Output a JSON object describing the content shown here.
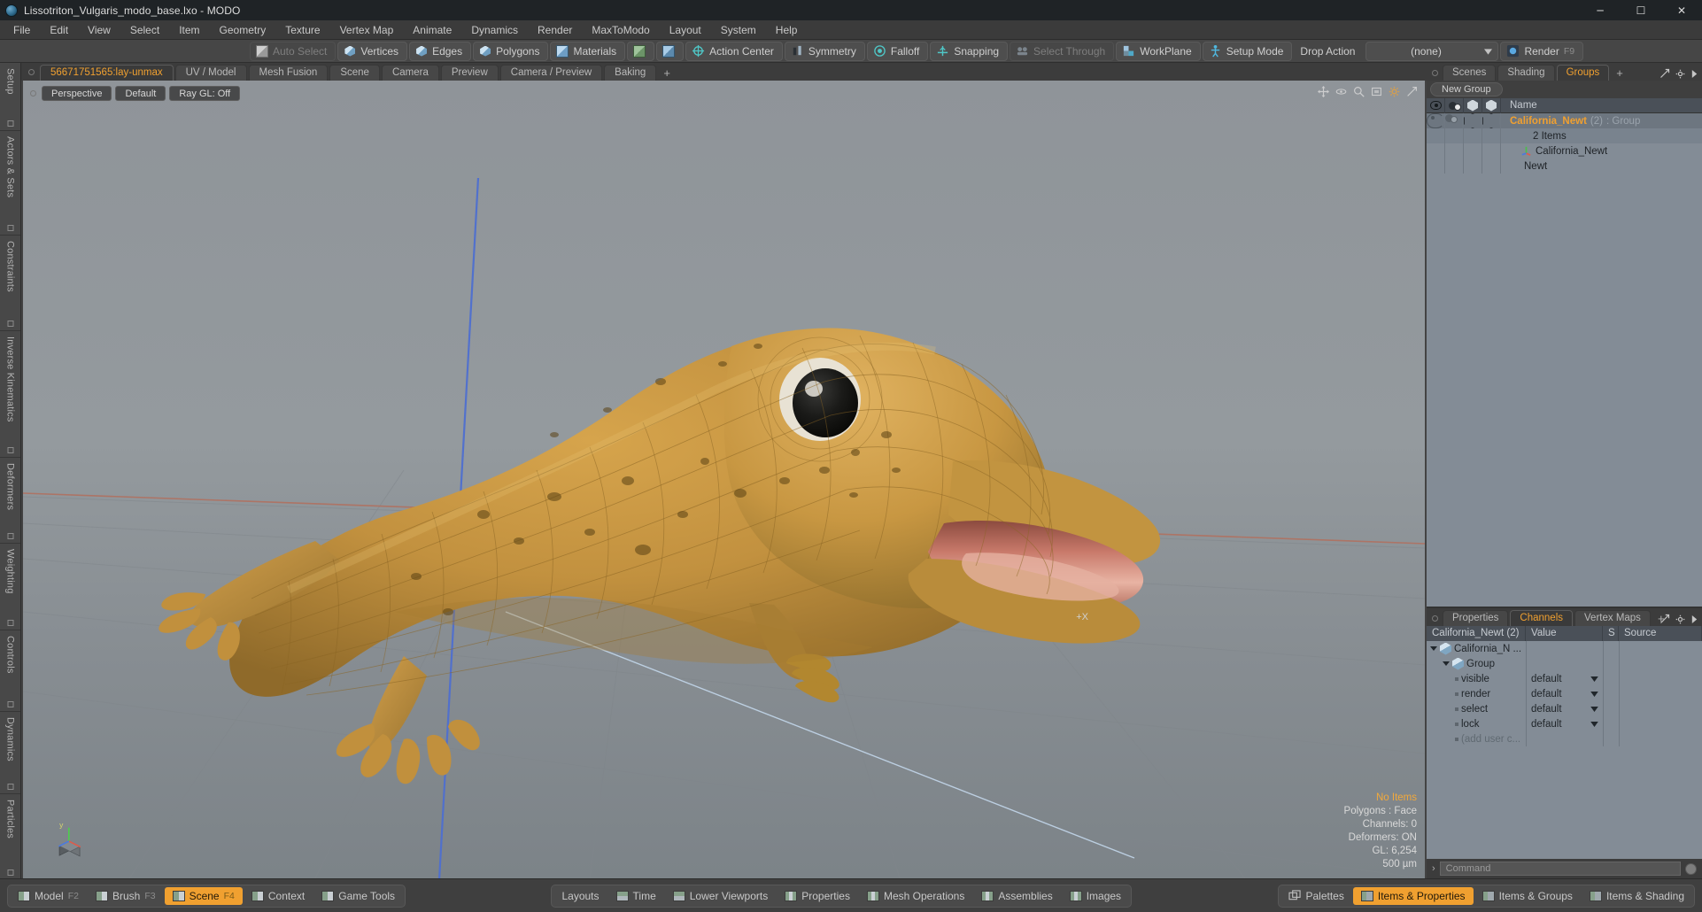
{
  "window": {
    "title": "Lissotriton_Vulgaris_modo_base.lxo - MODO",
    "app_icon": "modo-logo-icon",
    "minimize": "─",
    "maximize": "☐",
    "close": "✕"
  },
  "menubar": {
    "items": [
      "File",
      "Edit",
      "View",
      "Select",
      "Item",
      "Geometry",
      "Texture",
      "Vertex Map",
      "Animate",
      "Dynamics",
      "Render",
      "MaxToModo",
      "Layout",
      "System",
      "Help"
    ]
  },
  "toolbar": {
    "buttons": [
      {
        "label": "Auto Select",
        "icon": "cube-grey-icon",
        "state": "dimmed"
      },
      {
        "label": "Vertices",
        "icon": "cube-vertices-icon",
        "state": "normal"
      },
      {
        "label": "Edges",
        "icon": "cube-edges-icon",
        "state": "normal"
      },
      {
        "label": "Polygons",
        "icon": "cube-polygons-icon",
        "state": "normal"
      },
      {
        "label": "Materials",
        "icon": "cube-materials-icon",
        "state": "normal"
      },
      {
        "label": "",
        "icon": "item-mode-icon",
        "state": "normal"
      },
      {
        "label": "",
        "icon": "center-mode-icon",
        "state": "normal"
      },
      {
        "label": "Action Center",
        "icon": "action-center-icon",
        "state": "normal"
      },
      {
        "label": "Symmetry",
        "icon": "symmetry-icon",
        "state": "normal"
      },
      {
        "label": "Falloff",
        "icon": "falloff-icon",
        "state": "normal"
      },
      {
        "label": "Snapping",
        "icon": "snapping-icon",
        "state": "normal"
      },
      {
        "label": "Select Through",
        "icon": "select-through-icon",
        "state": "dimmed"
      },
      {
        "label": "WorkPlane",
        "icon": "workplane-icon",
        "state": "normal"
      },
      {
        "label": "Setup Mode",
        "icon": "setup-mode-icon",
        "state": "normal"
      },
      {
        "label": "Drop Action",
        "icon": "",
        "state": "plain"
      }
    ],
    "drop_action_value": "(none)",
    "render_label": "Render",
    "render_shortcut": "F9",
    "render_icon": "render-icon"
  },
  "left_rail": {
    "tabs": [
      "Setup",
      "Actors & Sets",
      "Constraints",
      "Inverse Kinematics",
      "Deformers",
      "Weighting",
      "Controls",
      "Dynamics",
      "Particles"
    ]
  },
  "viewport_tabs": {
    "tabs": [
      {
        "label": "56671751565:lay-unmax",
        "active": true
      },
      {
        "label": "UV / Model",
        "active": false
      },
      {
        "label": "Mesh Fusion",
        "active": false
      },
      {
        "label": "Scene",
        "active": false
      },
      {
        "label": "Camera",
        "active": false
      },
      {
        "label": "Preview",
        "active": false
      },
      {
        "label": "Camera / Preview",
        "active": false
      },
      {
        "label": "Baking",
        "active": false
      }
    ],
    "add_tab": "+"
  },
  "viewport": {
    "view_mode": "Perspective",
    "shading_mode": "Default",
    "raygl": "Ray GL: Off",
    "center_mark": "+X",
    "info": {
      "items": "No Items",
      "polygons": "Polygons : Face",
      "channels": "Channels: 0",
      "deformers": "Deformers: ON",
      "gl": "GL: 6,254",
      "grid": "500 µm"
    },
    "gizmo_axis_y": "y",
    "subject": "3d-newt-model"
  },
  "groups_panel": {
    "tabs": [
      {
        "label": "Scenes",
        "active": false
      },
      {
        "label": "Shading",
        "active": false
      },
      {
        "label": "Groups",
        "active": true
      }
    ],
    "add_tab": "+",
    "new_group_button": "New Group",
    "columns": {
      "visible_icon": "eye-icon",
      "render_icon": "render-visibility-icon",
      "select_icon": "selectable-icon",
      "lock_icon": "lock-icon",
      "name": "Name"
    },
    "rows": [
      {
        "name": "California_Newt",
        "count": "(2)",
        "type": ": Group",
        "sub": "2 Items",
        "selected": true,
        "icon": "group-icon",
        "indent": 0
      },
      {
        "name": "California_Newt",
        "icon": "locator-icon",
        "indent": 1
      },
      {
        "name": "Newt",
        "icon": "mesh-icon",
        "indent": 1
      }
    ]
  },
  "channels_panel": {
    "tabs": [
      {
        "label": "Properties",
        "active": false
      },
      {
        "label": "Channels",
        "active": true
      },
      {
        "label": "Vertex Maps",
        "active": false
      }
    ],
    "add_tab": "+",
    "columns": [
      "California_Newt (2)",
      "Value",
      "S",
      "Source"
    ],
    "rows": [
      {
        "name": "California_N ...",
        "value": "",
        "depth": 0,
        "icon": "group-icon",
        "expander": "down"
      },
      {
        "name": "Group",
        "value": "",
        "depth": 1,
        "icon": "group-icon",
        "expander": "down"
      },
      {
        "name": "visible",
        "value": "default",
        "depth": 2,
        "icon": "channel-dot",
        "dropdown": true
      },
      {
        "name": "render",
        "value": "default",
        "depth": 2,
        "icon": "channel-dot",
        "dropdown": true
      },
      {
        "name": "select",
        "value": "default",
        "depth": 2,
        "icon": "channel-dot",
        "dropdown": true
      },
      {
        "name": "lock",
        "value": "default",
        "depth": 2,
        "icon": "channel-dot",
        "dropdown": true
      },
      {
        "name": "(add user c...",
        "value": "",
        "depth": 2,
        "icon": "channel-dot",
        "muted": true
      }
    ]
  },
  "command_line": {
    "prompt": "›",
    "placeholder": "Command",
    "value": ""
  },
  "statusbar": {
    "left_group": [
      {
        "label": "Model",
        "fkey": "F2",
        "icon": "layout-model-icon",
        "active": false
      },
      {
        "label": "Brush",
        "fkey": "F3",
        "icon": "layout-brush-icon",
        "active": false
      },
      {
        "label": "Scene",
        "fkey": "F4",
        "icon": "layout-scene-icon",
        "active": true
      },
      {
        "label": "Context",
        "fkey": "",
        "icon": "layout-context-icon",
        "active": false
      },
      {
        "label": "Game Tools",
        "fkey": "",
        "icon": "layout-gametools-icon",
        "active": false
      }
    ],
    "center_group": [
      {
        "label": "Layouts",
        "icon": "",
        "active": false
      },
      {
        "label": "Time",
        "icon": "panel-time-icon",
        "active": false
      },
      {
        "label": "Lower Viewports",
        "icon": "panel-lowerviewports-icon",
        "active": false
      },
      {
        "label": "Properties",
        "icon": "panel-properties-icon",
        "active": false
      },
      {
        "label": "Mesh Operations",
        "icon": "panel-meshops-icon",
        "active": false
      },
      {
        "label": "Assemblies",
        "icon": "panel-assemblies-icon",
        "active": false
      },
      {
        "label": "Images",
        "icon": "panel-images-icon",
        "active": false
      }
    ],
    "right_group": [
      {
        "label": "Palettes",
        "icon": "palettes-icon",
        "active": false
      },
      {
        "label": "Items & Properties",
        "icon": "panel-items-props-icon",
        "active": true
      },
      {
        "label": "Items & Groups",
        "icon": "panel-items-groups-icon",
        "active": false
      },
      {
        "label": "Items & Shading",
        "icon": "panel-items-shading-icon",
        "active": false
      }
    ]
  },
  "colors": {
    "accent": "#f0a030",
    "panel_bg": "#3c3c3c",
    "tree_bg": "#838c96",
    "titlebar": "#1f2326"
  }
}
